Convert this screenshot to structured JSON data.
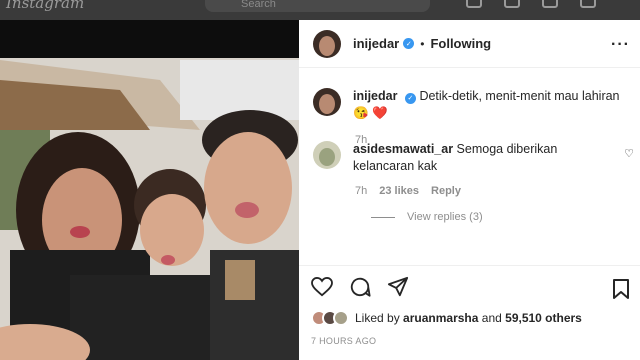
{
  "topbar": {
    "logo": "Instagram",
    "search_placeholder": "Search"
  },
  "post": {
    "username": "inijedar",
    "follow_status": "Following",
    "caption_username": "inijedar",
    "caption_text": "Detik-detik, menit-menit mau lahiran😘 ❤️",
    "caption_time": "7h"
  },
  "comment": {
    "username": "asidesmawati_ar",
    "text": "Semoga diberikan kelancaran kak",
    "time": "7h",
    "likes": "23 likes",
    "reply_label": "Reply",
    "view_replies": "View replies (3)"
  },
  "likes": {
    "prefix": "Liked by",
    "liker": "aruanmarsha",
    "joiner": "and",
    "count": "59,510 others"
  },
  "timestamp": "7 HOURS AGO",
  "colors": {
    "verified": "#3897f0",
    "muted": "#8e8e8e",
    "text": "#262626"
  }
}
